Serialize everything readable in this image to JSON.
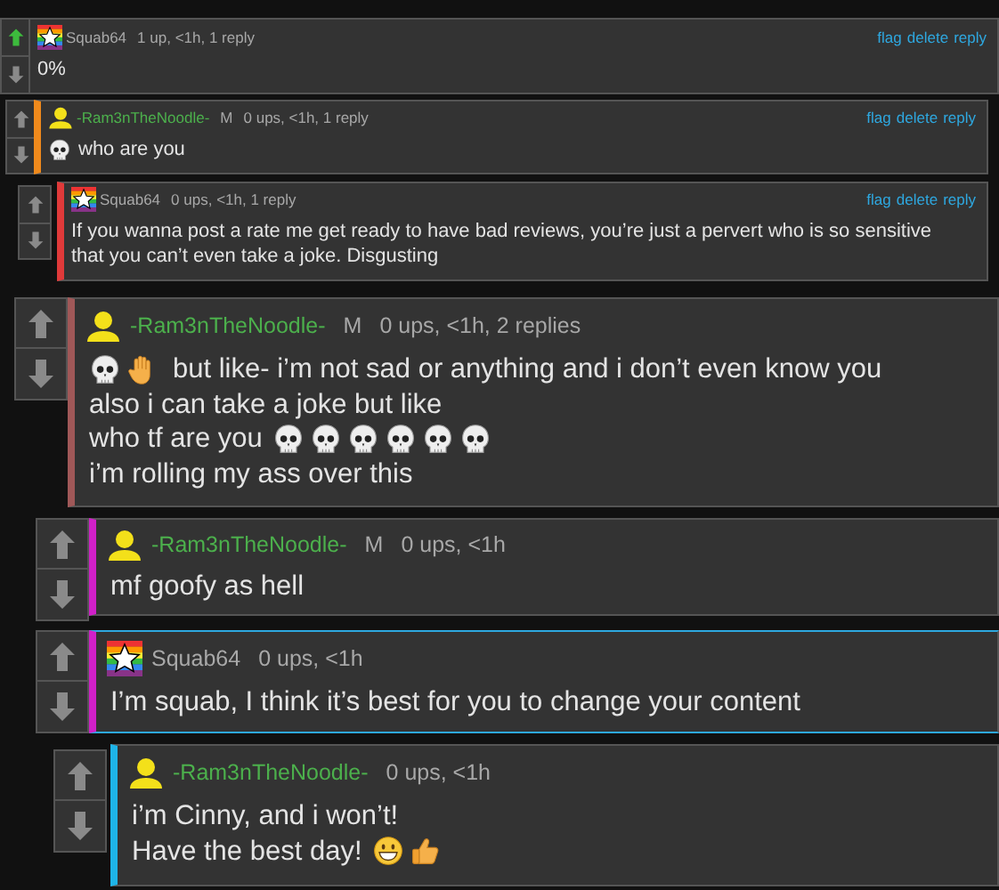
{
  "comments": [
    {
      "author": {
        "name": "Squab64",
        "color": "#a9a9a9",
        "kind": "rainbow"
      },
      "meta": "1 up, <1h, 1 reply",
      "upvoted": true,
      "downvoted": false,
      "highlighted": false,
      "actions": [
        "flag",
        "delete",
        "reply"
      ],
      "body": [
        [
          {
            "kind": "text",
            "text": "0%"
          }
        ]
      ]
    },
    {
      "author": {
        "name": "-Ram3nTheNoodle-",
        "color": "#4cb04c",
        "kind": "yellow"
      },
      "mod": "M",
      "meta": "0 ups, <1h, 1 reply",
      "upvoted": false,
      "downvoted": false,
      "highlighted": false,
      "color": "#f08a1c",
      "actions": [
        "flag",
        "delete",
        "reply"
      ],
      "body": [
        [
          {
            "kind": "skull"
          },
          {
            "kind": "text",
            "text": "who are you"
          }
        ]
      ]
    },
    {
      "author": {
        "name": "Squab64",
        "color": "#a9a9a9",
        "kind": "rainbow"
      },
      "meta": "0 ups, <1h, 1 reply",
      "upvoted": false,
      "downvoted": false,
      "highlighted": false,
      "color": "#e03a3a",
      "actions": [
        "flag",
        "delete",
        "reply"
      ],
      "body": [
        [
          {
            "kind": "text",
            "text": "If you wanna post a rate me get ready to have bad reviews, you’re just a pervert who is so sensitive that you can’t even take a joke. Disgusting"
          }
        ]
      ]
    },
    {
      "author": {
        "name": "-Ram3nTheNoodle-",
        "color": "#4cb04c",
        "kind": "yellow"
      },
      "mod": "M",
      "meta": "0 ups, <1h, 2 replies",
      "upvoted": false,
      "downvoted": false,
      "highlighted": false,
      "color": "#a05858",
      "body": [
        [
          {
            "kind": "skull"
          },
          {
            "kind": "hand"
          },
          {
            "kind": "text",
            "text": "but like- i’m not sad or anything and i don’t even know you"
          }
        ],
        [
          {
            "kind": "text",
            "text": "also i can take a joke but like"
          }
        ],
        [
          {
            "kind": "text",
            "text": "who tf are you"
          },
          {
            "kind": "skull"
          },
          {
            "kind": "skull"
          },
          {
            "kind": "skull"
          },
          {
            "kind": "skull"
          },
          {
            "kind": "skull"
          },
          {
            "kind": "skull"
          }
        ],
        [
          {
            "kind": "text",
            "text": "i’m rolling my ass over this"
          }
        ]
      ]
    },
    {
      "author": {
        "name": "-Ram3nTheNoodle-",
        "color": "#4cb04c",
        "kind": "yellow"
      },
      "mod": "M",
      "meta": "0 ups, <1h",
      "upvoted": false,
      "downvoted": false,
      "highlighted": false,
      "color": "#d020c8",
      "body": [
        [
          {
            "kind": "text",
            "text": "mf goofy as hell"
          }
        ]
      ]
    },
    {
      "author": {
        "name": "Squab64",
        "color": "#a9a9a9",
        "kind": "rainbow"
      },
      "meta": "0 ups, <1h",
      "upvoted": false,
      "downvoted": false,
      "highlighted": true,
      "color": "#d020c8",
      "body": [
        [
          {
            "kind": "text",
            "text": "I’m squab, I think it’s best for you to change your content"
          }
        ]
      ]
    },
    {
      "author": {
        "name": "-Ram3nTheNoodle-",
        "color": "#4cb04c",
        "kind": "yellow"
      },
      "meta": "0 ups, <1h",
      "upvoted": false,
      "downvoted": false,
      "highlighted": false,
      "color": "#1eb4e8",
      "body": [
        [
          {
            "kind": "text",
            "text": "i’m Cinny, and i won’t!"
          }
        ],
        [
          {
            "kind": "text",
            "text": "Have the best day!"
          },
          {
            "kind": "grin"
          },
          {
            "kind": "thumbs"
          }
        ]
      ]
    }
  ]
}
